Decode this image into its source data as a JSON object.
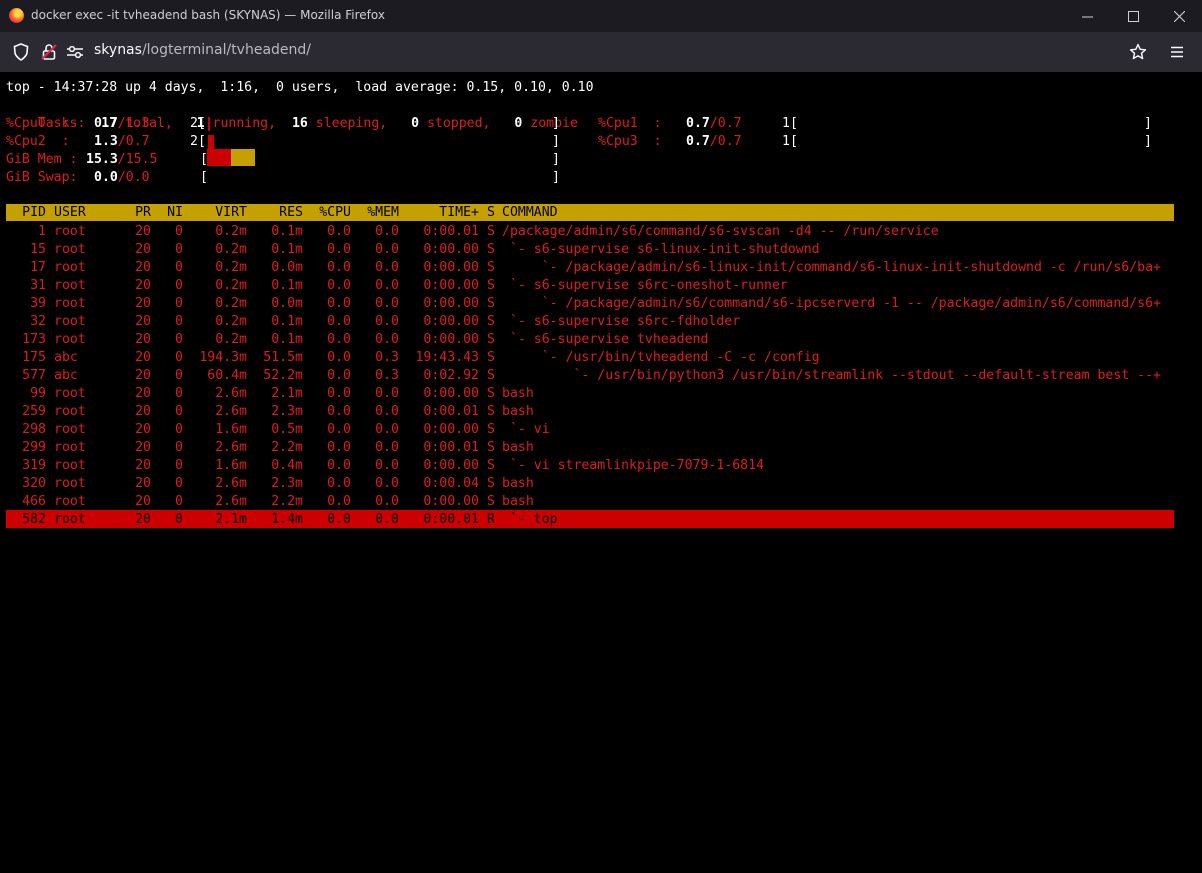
{
  "window": {
    "title": "docker exec -it tvheadend bash (SKYNAS) — Mozilla Firefox",
    "url_host": "skynas",
    "url_path": "/logterminal/tvheadend/"
  },
  "top": {
    "summary_line": "top - 14:37:28 up 4 days,  1:16,  0 users,  load average: 0.15, 0.10, 0.10",
    "tasks": {
      "label": "Tasks:",
      "total": "17",
      "total_label": "total,",
      "running": "1",
      "running_label": "running,",
      "sleeping": "16",
      "sleeping_label": "sleeping,",
      "stopped": "0",
      "stopped_label": "stopped,",
      "zombie": "0",
      "zombie_label": "zombie"
    },
    "meters": [
      {
        "label": "%Cpu0  :",
        "val": "0.7",
        "sep": "/",
        "val2": "1.3",
        "num": "2[",
        "end": "]"
      },
      {
        "label": "%Cpu1  :",
        "val": "0.7",
        "sep": "/",
        "val2": "0.7",
        "num": "1[",
        "end": "]"
      },
      {
        "label": "%Cpu2  :",
        "val": "1.3",
        "sep": "/",
        "val2": "0.7",
        "num": "2[",
        "end": "]"
      },
      {
        "label": "%Cpu3  :",
        "val": "0.7",
        "sep": "/",
        "val2": "0.7",
        "num": "1[",
        "end": "]"
      },
      {
        "label": "GiB Mem :",
        "val": "15.3",
        "sep": "/",
        "val2": "15.5",
        "num": "[",
        "end": "]"
      },
      {
        "label": "GiB Swap:",
        "val": "0.0",
        "sep": "/",
        "val2": "0.0",
        "num": "[",
        "end": "]"
      }
    ],
    "columns": [
      "PID",
      "USER",
      "PR",
      "NI",
      "VIRT",
      "RES",
      "%CPU",
      "%MEM",
      "TIME+",
      "S",
      "COMMAND"
    ],
    "rows": [
      [
        "1",
        "root",
        "20",
        "0",
        "0.2m",
        "0.1m",
        "0.0",
        "0.0",
        "0:00.01",
        "S",
        "/package/admin/s6/command/s6-svscan -d4 -- /run/service"
      ],
      [
        "15",
        "root",
        "20",
        "0",
        "0.2m",
        "0.1m",
        "0.0",
        "0.0",
        "0:00.00",
        "S",
        " `- s6-supervise s6-linux-init-shutdownd"
      ],
      [
        "17",
        "root",
        "20",
        "0",
        "0.2m",
        "0.0m",
        "0.0",
        "0.0",
        "0:00.00",
        "S",
        "     `- /package/admin/s6-linux-init/command/s6-linux-init-shutdownd -c /run/s6/ba+"
      ],
      [
        "31",
        "root",
        "20",
        "0",
        "0.2m",
        "0.1m",
        "0.0",
        "0.0",
        "0:00.00",
        "S",
        " `- s6-supervise s6rc-oneshot-runner"
      ],
      [
        "39",
        "root",
        "20",
        "0",
        "0.2m",
        "0.0m",
        "0.0",
        "0.0",
        "0:00.00",
        "S",
        "     `- /package/admin/s6/command/s6-ipcserverd -1 -- /package/admin/s6/command/s6+"
      ],
      [
        "32",
        "root",
        "20",
        "0",
        "0.2m",
        "0.1m",
        "0.0",
        "0.0",
        "0:00.00",
        "S",
        " `- s6-supervise s6rc-fdholder"
      ],
      [
        "173",
        "root",
        "20",
        "0",
        "0.2m",
        "0.1m",
        "0.0",
        "0.0",
        "0:00.00",
        "S",
        " `- s6-supervise tvheadend"
      ],
      [
        "175",
        "abc",
        "20",
        "0",
        "194.3m",
        "51.5m",
        "0.0",
        "0.3",
        "19:43.43",
        "S",
        "     `- /usr/bin/tvheadend -C -c /config"
      ],
      [
        "577",
        "abc",
        "20",
        "0",
        "60.4m",
        "52.2m",
        "0.0",
        "0.3",
        "0:02.92",
        "S",
        "         `- /usr/bin/python3 /usr/bin/streamlink --stdout --default-stream best --+"
      ],
      [
        "99",
        "root",
        "20",
        "0",
        "2.6m",
        "2.1m",
        "0.0",
        "0.0",
        "0:00.00",
        "S",
        "bash"
      ],
      [
        "259",
        "root",
        "20",
        "0",
        "2.6m",
        "2.3m",
        "0.0",
        "0.0",
        "0:00.01",
        "S",
        "bash"
      ],
      [
        "298",
        "root",
        "20",
        "0",
        "1.6m",
        "0.5m",
        "0.0",
        "0.0",
        "0:00.00",
        "S",
        " `- vi"
      ],
      [
        "299",
        "root",
        "20",
        "0",
        "2.6m",
        "2.2m",
        "0.0",
        "0.0",
        "0:00.01",
        "S",
        "bash"
      ],
      [
        "319",
        "root",
        "20",
        "0",
        "1.6m",
        "0.4m",
        "0.0",
        "0.0",
        "0:00.00",
        "S",
        " `- vi streamlinkpipe-7079-1-6814"
      ],
      [
        "320",
        "root",
        "20",
        "0",
        "2.6m",
        "2.3m",
        "0.0",
        "0.0",
        "0:00.04",
        "S",
        "bash"
      ],
      [
        "466",
        "root",
        "20",
        "0",
        "2.6m",
        "2.2m",
        "0.0",
        "0.0",
        "0:00.00",
        "S",
        "bash"
      ],
      [
        "582",
        "root",
        "20",
        "0",
        "2.1m",
        "1.4m",
        "0.0",
        "0.0",
        "0:00.01",
        "R",
        " `- top"
      ]
    ],
    "selected_row": 16,
    "mem_meter": {
      "used_fraction": 0.05,
      "cache_fraction": 0.05
    },
    "colors": {
      "header_bg": "#c4a000",
      "selected_bg": "#cc0000",
      "text_red": "#dd1d1d"
    }
  }
}
